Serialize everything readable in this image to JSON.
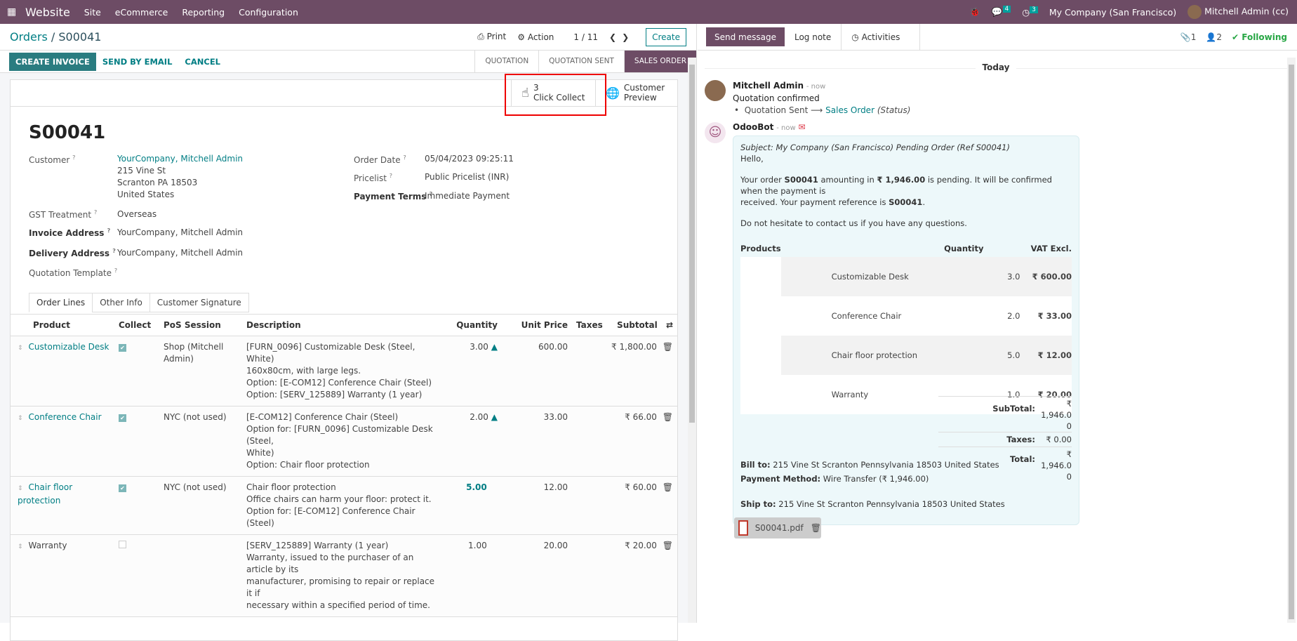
{
  "topbar": {
    "app": "Website",
    "menus": [
      "Site",
      "eCommerce",
      "Reporting",
      "Configuration"
    ],
    "messages_count": "4",
    "activities_count": "3",
    "company": "My Company (San Francisco)",
    "user": "Mitchell Admin (cc)"
  },
  "control": {
    "breadcrumb_parent": "Orders",
    "breadcrumb_current": "S00041",
    "print": "Print",
    "action": "Action",
    "pager": "1 / 11",
    "create": "Create"
  },
  "actions": {
    "create_invoice": "CREATE INVOICE",
    "send_email": "SEND BY EMAIL",
    "cancel": "CANCEL"
  },
  "status": [
    "QUOTATION",
    "QUOTATION SENT",
    "SALES ORDER"
  ],
  "smart": {
    "click_collect_count": "3",
    "click_collect": "Click Collect",
    "customer_preview_1": "Customer",
    "customer_preview_2": "Preview"
  },
  "form": {
    "name": "S00041",
    "customer_label": "Customer",
    "customer": "YourCompany, Mitchell Admin",
    "addr1": "215 Vine St",
    "addr2": "Scranton PA 18503",
    "addr3": "United States",
    "gst_label": "GST Treatment",
    "gst": "Overseas",
    "invoice_label": "Invoice Address",
    "invoice": "YourCompany, Mitchell Admin",
    "delivery_label": "Delivery Address",
    "delivery": "YourCompany, Mitchell Admin",
    "template_label": "Quotation Template",
    "date_label": "Order Date",
    "date": "05/04/2023 09:25:11",
    "pricelist_label": "Pricelist",
    "pricelist": "Public Pricelist (INR)",
    "terms_label": "Payment Terms",
    "terms": "Immediate Payment"
  },
  "tabs": [
    "Order Lines",
    "Other Info",
    "Customer Signature"
  ],
  "lines": {
    "headers": [
      "Product",
      "Collect",
      "PoS Session",
      "Description",
      "Quantity",
      "Unit Price",
      "Taxes",
      "Subtotal"
    ],
    "rows": [
      {
        "product": "Customizable Desk",
        "collect": true,
        "pos": "Shop (Mitchell Admin)",
        "desc": [
          "[FURN_0096] Customizable Desk (Steel, White)",
          "160x80cm, with large legs.",
          "Option: [E-COM12] Conference Chair (Steel)",
          "Option: [SERV_125889] Warranty (1 year)"
        ],
        "qty": "3.00",
        "price": "600.00",
        "subtotal": "₹ 1,800.00"
      },
      {
        "product": "Conference Chair",
        "collect": true,
        "pos": "NYC (not used)",
        "desc": [
          "[E-COM12] Conference Chair (Steel)",
          "Option for: [FURN_0096] Customizable Desk (Steel,",
          "White)",
          "Option: Chair floor protection"
        ],
        "qty": "2.00",
        "price": "33.00",
        "subtotal": "₹ 66.00"
      },
      {
        "product": "Chair floor protection",
        "collect": true,
        "pos": "NYC (not used)",
        "desc": [
          "Chair floor protection",
          "Office chairs can harm your floor: protect it.",
          "Option for: [E-COM12] Conference Chair (Steel)"
        ],
        "qty": "5.00",
        "price": "12.00",
        "subtotal": "₹ 60.00"
      },
      {
        "product": "Warranty",
        "collect": false,
        "pos": "",
        "desc": [
          "[SERV_125889] Warranty (1 year)",
          "Warranty, issued to the purchaser of an article by its",
          "manufacturer, promising to repair or replace it if",
          "necessary within a specified period of time."
        ],
        "qty": "1.00",
        "price": "20.00",
        "subtotal": "₹ 20.00"
      }
    ]
  },
  "chatter": {
    "send": "Send message",
    "log": "Log note",
    "activities": "Activities",
    "attachments": "1",
    "followers": "2",
    "following": "Following",
    "today": "Today",
    "m1": {
      "author": "Mitchell Admin",
      "time": "- now",
      "body": "Quotation confirmed",
      "old": "Quotation Sent",
      "arrow": "⟶",
      "new": "Sales Order",
      "field": "(Status)"
    },
    "m2": {
      "author": "OdooBot",
      "time": "- now",
      "subject": "Subject: My Company (San Francisco) Pending Order (Ref S00041)",
      "hello": "Hello,",
      "p1a": "Your order ",
      "p1b": "S00041",
      "p1c": " amounting in ",
      "p1d": "₹ 1,946.00",
      "p1e": " is pending. It will be confirmed when the payment is",
      "p1f": "received. Your payment reference is ",
      "p1g": "S00041",
      "p1h": ".",
      "p2": "Do not hesitate to contact us if you have any questions.",
      "headers": [
        "Products",
        "Quantity",
        "VAT Excl."
      ],
      "products": [
        {
          "name": "Customizable Desk",
          "qty": "3.0",
          "price": "₹ 600.00"
        },
        {
          "name": "Conference Chair",
          "qty": "2.0",
          "price": "₹ 33.00"
        },
        {
          "name": "Chair floor protection",
          "qty": "5.0",
          "price": "₹ 12.00"
        },
        {
          "name": "Warranty",
          "qty": "1.0",
          "price": "₹ 20.00"
        }
      ],
      "subtotal_label": "SubTotal:",
      "subtotal": "₹ 1,946.0 0",
      "taxes_label": "Taxes:",
      "taxes": "₹ 0.00",
      "total_label": "Total:",
      "total": "₹ 1,946.0 0",
      "bill_label": "Bill to:",
      "bill": " 215 Vine St Scranton Pennsylvania 18503 United States",
      "pay_label": "Payment Method:",
      "pay": " Wire Transfer (₹ 1,946.00)",
      "ship_label": "Ship to:",
      "ship": " 215 Vine St Scranton Pennsylvania 18503 United States"
    },
    "attachment": "S00041.pdf"
  }
}
